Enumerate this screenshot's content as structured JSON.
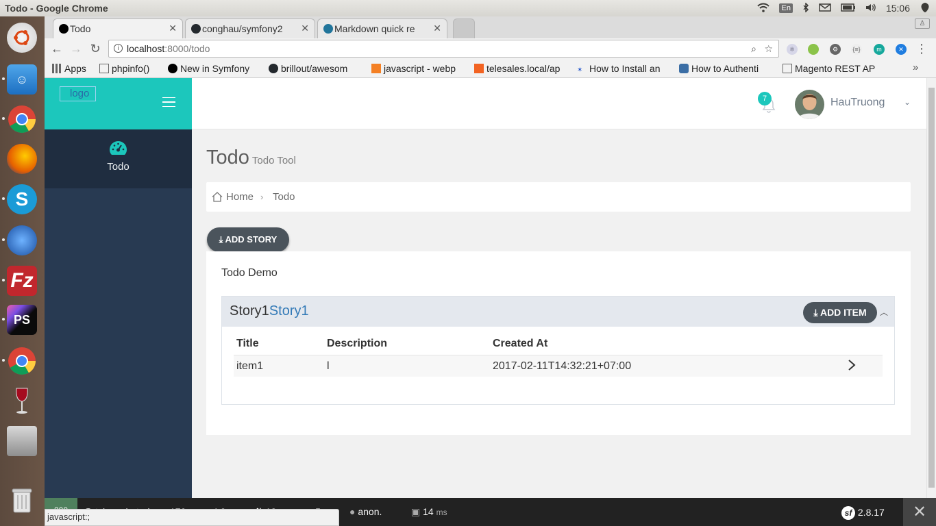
{
  "os": {
    "window_title": "Todo - Google Chrome",
    "keyboard_layout": "En",
    "clock": "15:06"
  },
  "tabs": [
    {
      "title": "Todo",
      "active": true
    },
    {
      "title": "conghau/symfony2",
      "active": false
    },
    {
      "title": "Markdown quick re",
      "active": false
    }
  ],
  "address_bar": {
    "host": "localhost",
    "rest": ":8000/todo"
  },
  "bookmarks": [
    "Apps",
    "phpinfo()",
    "New in Symfony",
    "brillout/awesom",
    "javascript - webp",
    "telesales.local/ap",
    "How to Install an",
    "How to Authenti",
    "Magento REST AP"
  ],
  "app": {
    "logo_alt": "logo",
    "nav": [
      {
        "label": "Todo",
        "icon": "dashboard-icon"
      }
    ],
    "notifications_count": "7",
    "user_name": "HauTruong",
    "page_title": "Todo",
    "page_subtitle": "Todo Tool",
    "breadcrumb": [
      "Home",
      "Todo"
    ],
    "add_story_label": "ADD STORY",
    "card_title": "Todo Demo",
    "story": {
      "name": "Story1",
      "link_text": "Story1",
      "add_item_label": "ADD ITEM",
      "columns": [
        "Title",
        "Description",
        "Created At"
      ],
      "rows": [
        {
          "title": "item1",
          "description": "l",
          "created_at": "2017-02-11T14:32:21+07:00"
        }
      ]
    }
  },
  "symfony_toolbar": {
    "status_code": "200",
    "route": "@ tch_web_todo",
    "time": "170",
    "time_unit": "ms",
    "memory": "4.0",
    "memory_unit": "MB",
    "queries": "18",
    "forms": "5",
    "user": "anon.",
    "twig_time": "14",
    "twig_unit": "ms",
    "version": "2.8.17"
  },
  "status_tooltip": "javascript:;",
  "colors": {
    "brand": "#1cc7bc",
    "sidebar": "#283a52",
    "button_dark": "#4b545c",
    "link": "#337ab7"
  }
}
